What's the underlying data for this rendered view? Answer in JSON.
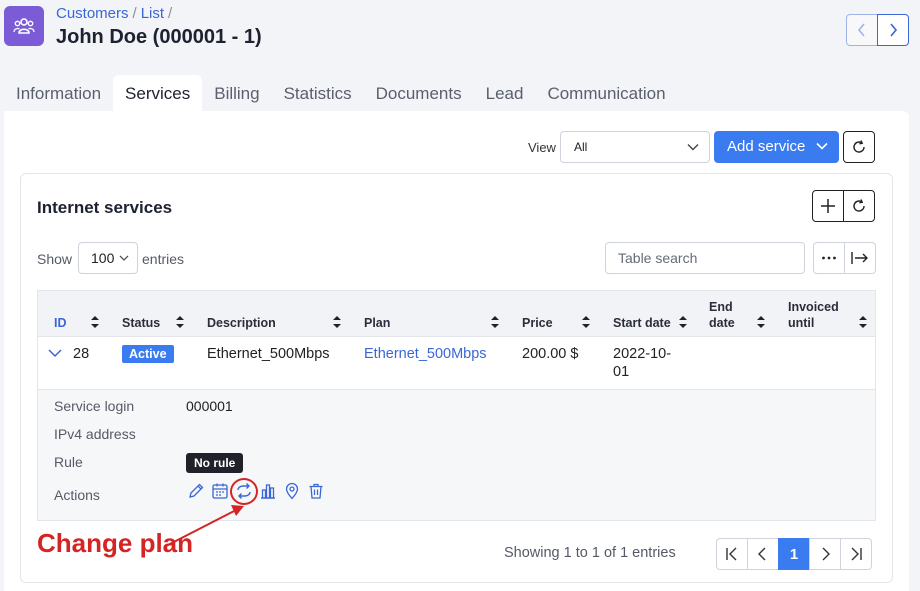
{
  "breadcrumb": {
    "items": [
      "Customers",
      "List"
    ],
    "separator": "/"
  },
  "page_title": "John Doe (000001 - 1)",
  "tabs": [
    "Information",
    "Services",
    "Billing",
    "Statistics",
    "Documents",
    "Lead",
    "Communication"
  ],
  "active_tab": "Services",
  "toolbar": {
    "view_label": "View",
    "view_value": "All",
    "add_service_label": "Add service"
  },
  "card": {
    "title": "Internet services",
    "show_label": "Show",
    "page_length": "100",
    "entries_label": "entries",
    "search_placeholder": "Table search"
  },
  "table": {
    "columns": [
      {
        "line1": "ID",
        "line2": ""
      },
      {
        "line1": "Status",
        "line2": ""
      },
      {
        "line1": "Description",
        "line2": ""
      },
      {
        "line1": "Plan",
        "line2": ""
      },
      {
        "line1": "Price",
        "line2": ""
      },
      {
        "line1": "Start date",
        "line2": ""
      },
      {
        "line1": "End",
        "line2": "date"
      },
      {
        "line1": "Invoiced",
        "line2": "until"
      }
    ],
    "rows": [
      {
        "id": "28",
        "status": "Active",
        "description": "Ethernet_500Mbps",
        "plan": "Ethernet_500Mbps",
        "price": "200.00 $",
        "start_date_line1": "2022-10-",
        "start_date_line2": "01",
        "end_date": "",
        "invoiced_until": ""
      }
    ]
  },
  "details": {
    "service_login_label": "Service login",
    "service_login_value": "000001",
    "ipv4_label": "IPv4 address",
    "ipv4_value": "",
    "rule_label": "Rule",
    "rule_value": "No rule",
    "actions_label": "Actions",
    "actions": [
      "edit-icon",
      "calendar-icon",
      "change-plan-icon",
      "bar-chart-icon",
      "location-icon",
      "trash-icon"
    ]
  },
  "annotation": {
    "text": "Change plan"
  },
  "footer": {
    "showing_text": "Showing 1 to 1 of 1 entries",
    "current_page": "1"
  },
  "colors": {
    "accent": "#3a7bf0",
    "link": "#3a66d6",
    "annotation": "#d42424",
    "app_icon": "#7b5cd6"
  }
}
